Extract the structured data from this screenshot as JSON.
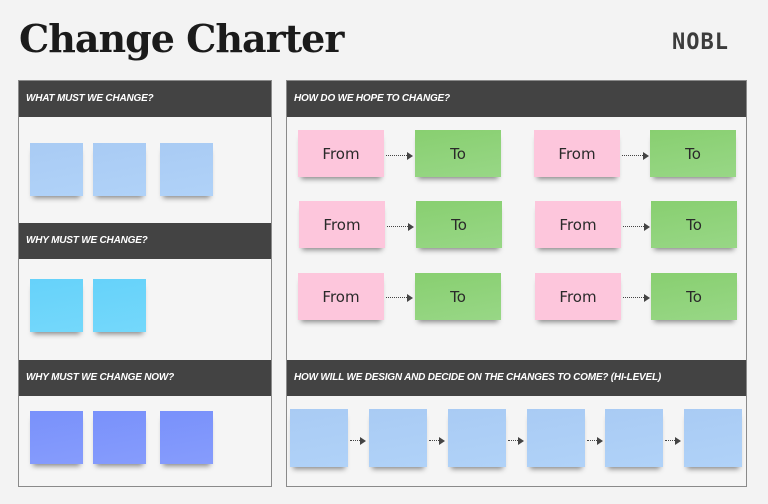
{
  "page": {
    "title": "Change Charter",
    "logo": "NOBL"
  },
  "sections": {
    "what": {
      "header": "What must we change?",
      "sticky_count": 3,
      "sticky_color": "#aacbf5"
    },
    "why": {
      "header": "Why must we change?",
      "sticky_count": 2,
      "sticky_color": "#69d3fa"
    },
    "why_now": {
      "header": "Why must we change now?",
      "sticky_count": 3,
      "sticky_color": "#7b93fb"
    },
    "how_hope": {
      "header": "How do we hope to change?",
      "from_color": "#fdc6dc",
      "to_color": "#8fd27a",
      "pairs": [
        {
          "from": "From",
          "to": "To"
        },
        {
          "from": "From",
          "to": "To"
        },
        {
          "from": "From",
          "to": "To"
        },
        {
          "from": "From",
          "to": "To"
        },
        {
          "from": "From",
          "to": "To"
        },
        {
          "from": "From",
          "to": "To"
        }
      ]
    },
    "how_design": {
      "header": "How will we design and decide on the changes to come? (Hi-Level)",
      "sticky_count": 6,
      "sticky_color": "#aacbf5"
    }
  }
}
